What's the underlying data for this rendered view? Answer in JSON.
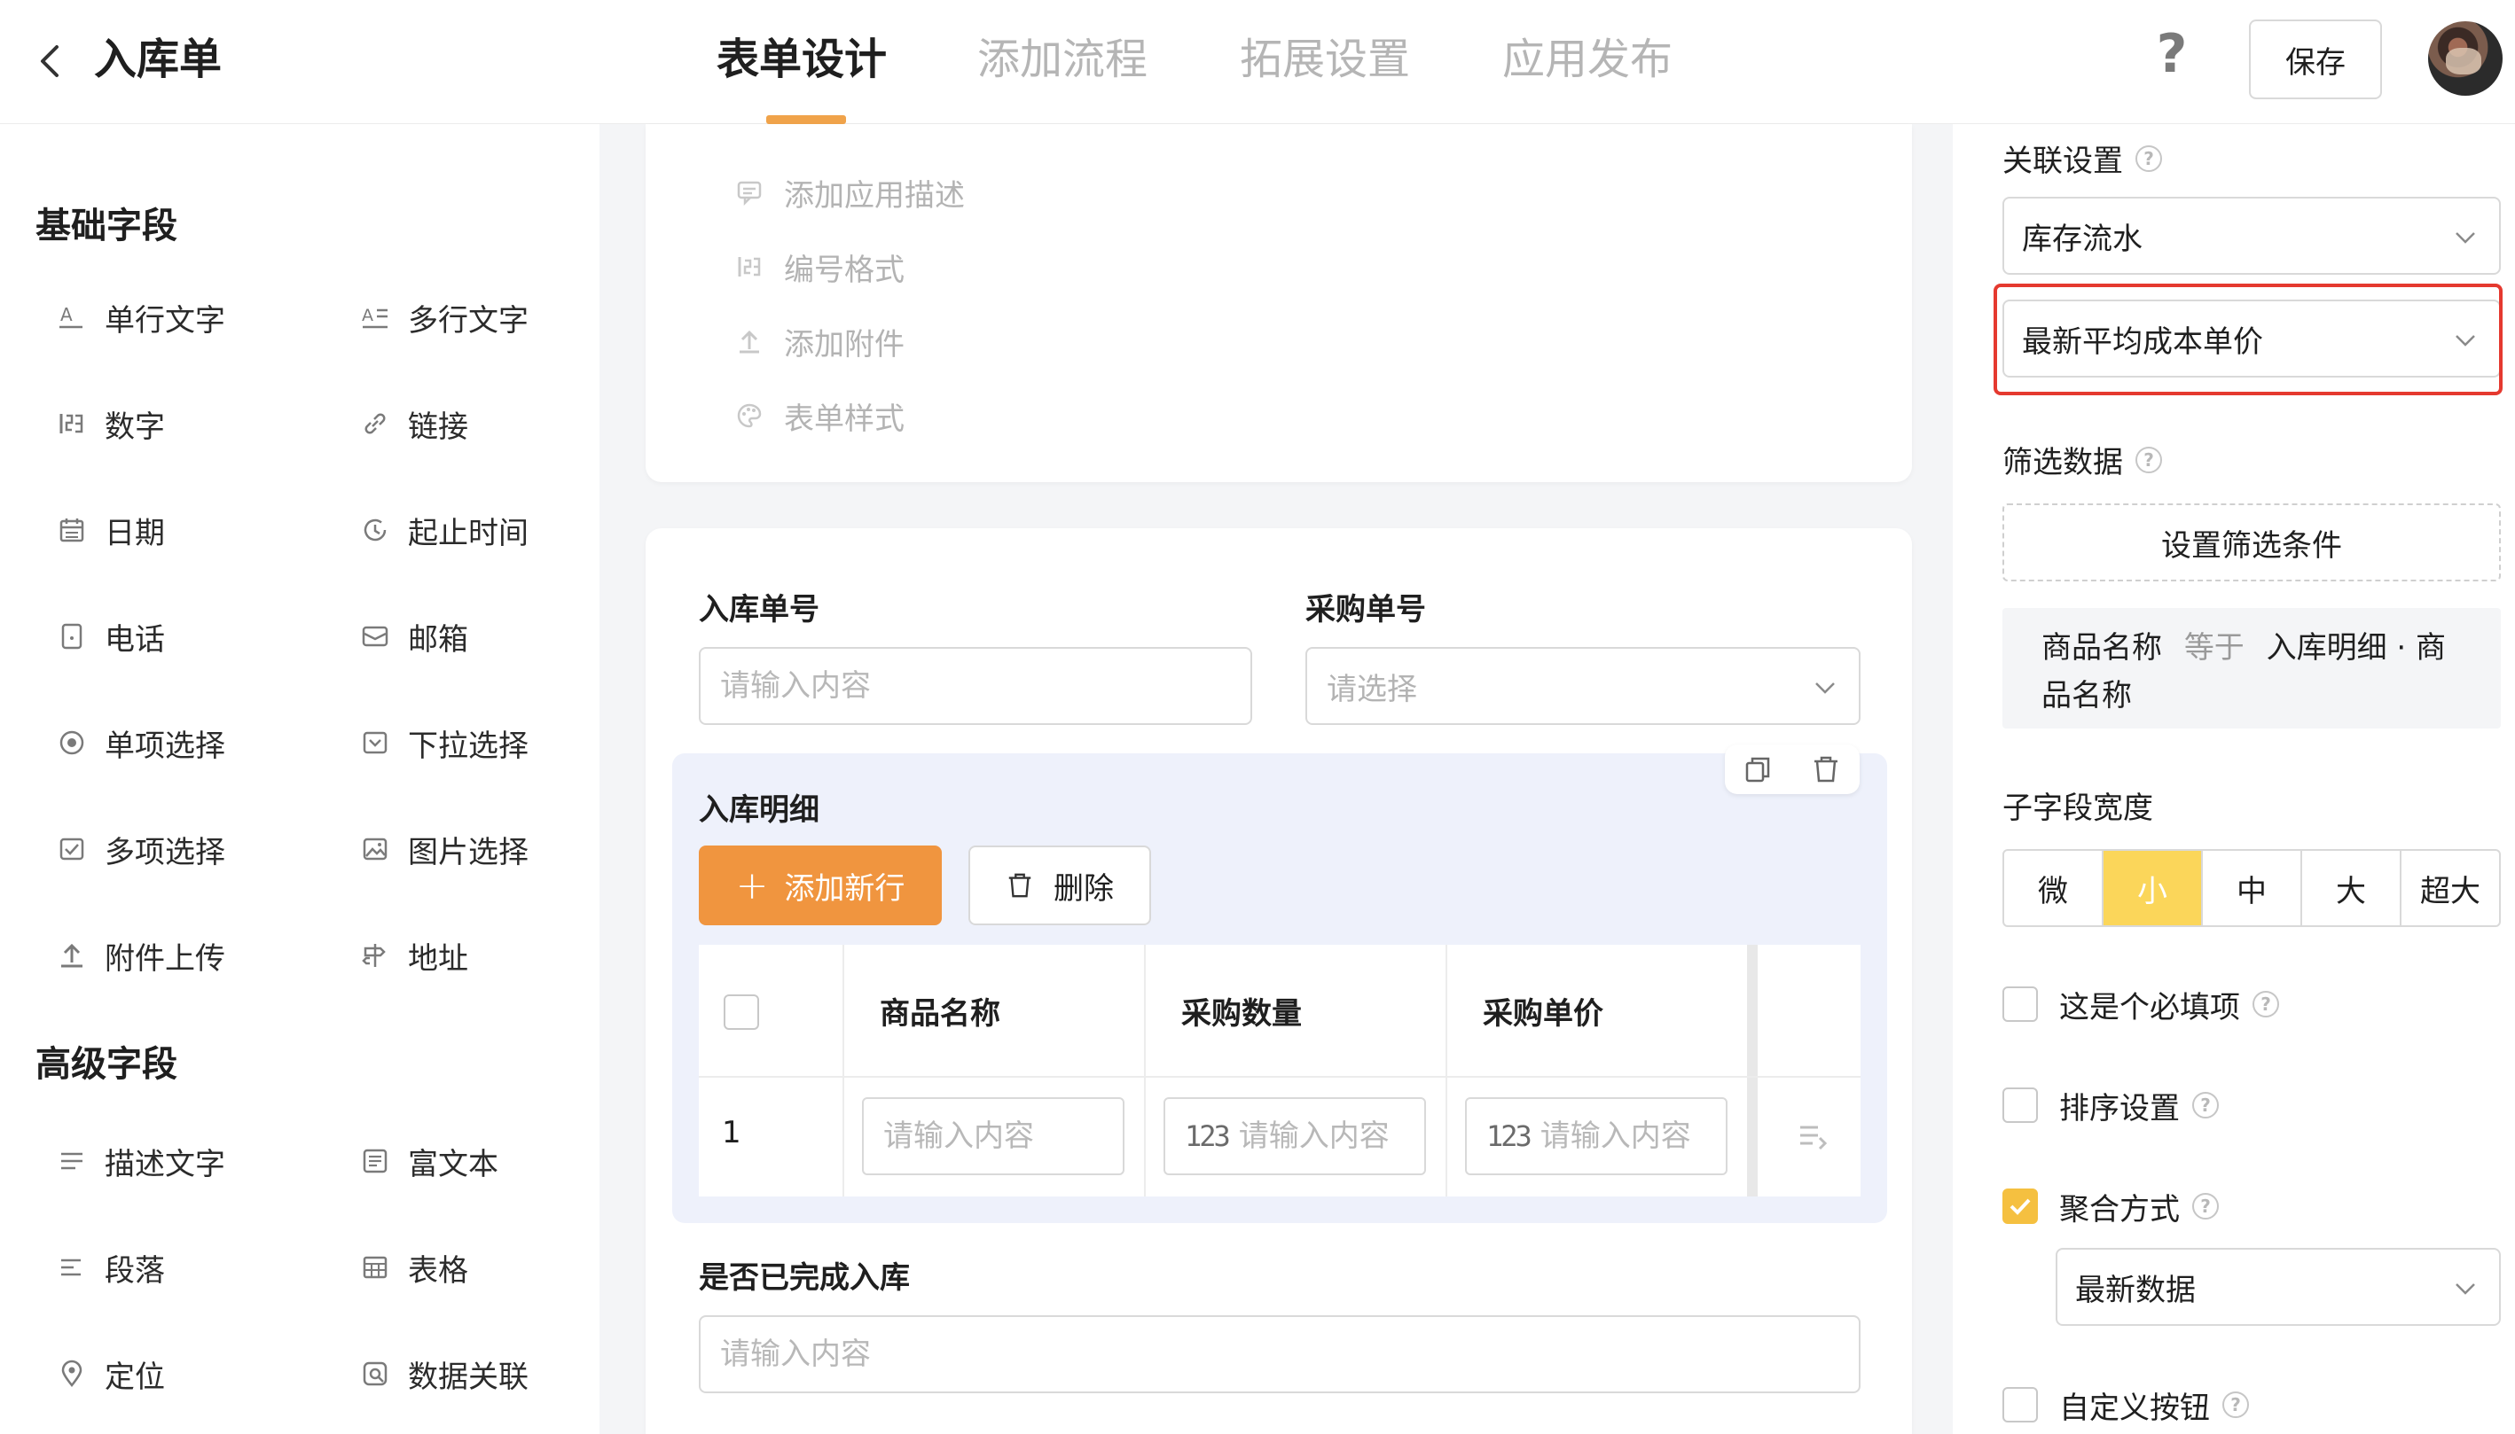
{
  "header": {
    "title": "入库单",
    "tabs": [
      {
        "label": "表单设计",
        "active": true
      },
      {
        "label": "添加流程",
        "active": false
      },
      {
        "label": "拓展设置",
        "active": false
      },
      {
        "label": "应用发布",
        "active": false
      }
    ],
    "help_label": "?",
    "save_label": "保存",
    "accent_color": "#f0a34a"
  },
  "sidebar": {
    "basic_title": "基础字段",
    "basic_items": [
      {
        "label": "单行文字",
        "icon": "single-line-text-icon"
      },
      {
        "label": "多行文字",
        "icon": "multi-line-text-icon"
      },
      {
        "label": "数字",
        "icon": "number-icon"
      },
      {
        "label": "链接",
        "icon": "link-icon"
      },
      {
        "label": "日期",
        "icon": "calendar-icon"
      },
      {
        "label": "起止时间",
        "icon": "time-range-icon"
      },
      {
        "label": "电话",
        "icon": "phone-icon"
      },
      {
        "label": "邮箱",
        "icon": "mail-icon"
      },
      {
        "label": "单项选择",
        "icon": "radio-icon"
      },
      {
        "label": "下拉选择",
        "icon": "dropdown-icon"
      },
      {
        "label": "多项选择",
        "icon": "checkbox-icon"
      },
      {
        "label": "图片选择",
        "icon": "image-icon"
      },
      {
        "label": "附件上传",
        "icon": "upload-icon"
      },
      {
        "label": "地址",
        "icon": "signpost-icon"
      }
    ],
    "advanced_title": "高级字段",
    "advanced_items": [
      {
        "label": "描述文字",
        "icon": "description-icon"
      },
      {
        "label": "富文本",
        "icon": "rich-text-icon"
      },
      {
        "label": "段落",
        "icon": "paragraph-icon"
      },
      {
        "label": "表格",
        "icon": "table-icon"
      },
      {
        "label": "定位",
        "icon": "location-icon"
      },
      {
        "label": "数据关联",
        "icon": "data-link-icon"
      }
    ]
  },
  "canvas": {
    "settings_items": [
      {
        "label": "添加应用描述",
        "icon": "comment-icon"
      },
      {
        "label": "编号格式",
        "icon": "number-format-icon"
      },
      {
        "label": "添加附件",
        "icon": "upload-icon"
      },
      {
        "label": "表单样式",
        "icon": "palette-icon"
      }
    ],
    "fields": {
      "receipt_no": {
        "label": "入库单号",
        "placeholder": "请输入内容"
      },
      "purchase_no": {
        "label": "采购单号",
        "placeholder": "请选择"
      }
    },
    "subform": {
      "title": "入库明细",
      "add_row_label": "添加新行",
      "delete_label": "删除",
      "columns": [
        "商品名称",
        "采购数量",
        "采购单价"
      ],
      "rows": [
        {
          "index": "1",
          "name_placeholder": "请输入内容",
          "qty_placeholder": "请输入内容",
          "price_placeholder": "请输入内容",
          "num_prefix": "123"
        }
      ],
      "bg_color": "#eef1fb"
    },
    "completed": {
      "label": "是否已完成入库",
      "placeholder": "请输入内容"
    }
  },
  "right_panel": {
    "link_settings_label": "关联设置",
    "link_form_value": "库存流水",
    "link_field_value": "最新平均成本单价",
    "filter_label": "筛选数据",
    "filter_button_label": "设置筛选条件",
    "condition": {
      "field": "商品名称",
      "op": "等于",
      "target": "入库明细 · 商品名称"
    },
    "width_label": "子字段宽度",
    "width_options": [
      {
        "label": "微",
        "active": false
      },
      {
        "label": "小",
        "active": true
      },
      {
        "label": "中",
        "active": false
      },
      {
        "label": "大",
        "active": false
      },
      {
        "label": "超大",
        "active": false
      }
    ],
    "required_label": "这是个必填项",
    "sort_label": "排序设置",
    "aggregate_label": "聚合方式",
    "aggregate_value": "最新数据",
    "custom_button_label": "自定义按钮",
    "highlight_color": "#e5392f",
    "active_option_color": "#fbd65a"
  }
}
